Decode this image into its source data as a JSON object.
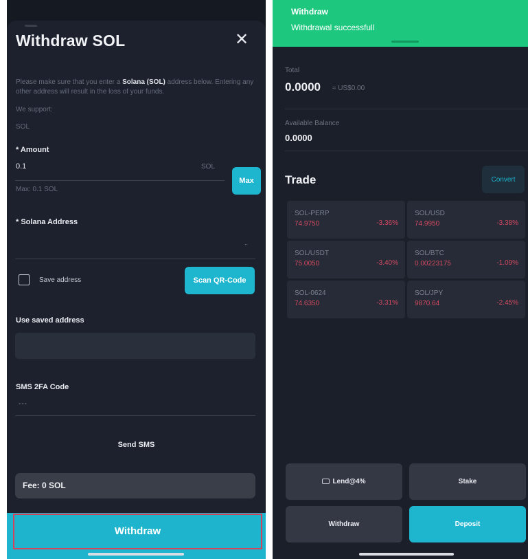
{
  "withdraw_form": {
    "title": "Withdraw SOL",
    "close_glyph": "✕",
    "warning_prefix": "Please make sure that you enter a ",
    "warning_bold": "Solana (SOL)",
    "warning_suffix": " address below. Entering any other address will result in the loss of your funds.",
    "support_label": "We support:",
    "support_value": "SOL",
    "amount_label": "* Amount",
    "amount_value": "0.1",
    "amount_unit": "SOL",
    "max_button": "Max",
    "max_hint": "Max: 0.1 SOL",
    "address_label": "* Solana Address",
    "address_dots": "..",
    "save_address_label": "Save address",
    "save_address_checked": false,
    "scan_qr_button": "Scan QR-Code",
    "saved_address_label": "Use saved address",
    "sms_label": "SMS 2FA Code",
    "sms_placeholder": "---",
    "send_sms": "Send SMS",
    "fee": "Fee: 0 SOL",
    "withdraw_button": "Withdraw"
  },
  "wallet": {
    "toast_title": "Withdraw",
    "toast_message": "Withdrawal successfull",
    "total_label": "Total",
    "total_value": "0.0000",
    "total_usd": "≈ US$0.00",
    "available_label": "Available Balance",
    "available_value": "0.0000",
    "trade_title": "Trade",
    "convert_button": "Convert",
    "markets": [
      {
        "name": "SOL-PERP",
        "price": "74.9750",
        "change": "-3.36%"
      },
      {
        "name": "SOL/USD",
        "price": "74.9950",
        "change": "-3.38%"
      },
      {
        "name": "SOL/USDT",
        "price": "75.0050",
        "change": "-3.40%"
      },
      {
        "name": "SOL/BTC",
        "price": "0.00223175",
        "change": "-1.09%"
      },
      {
        "name": "SOL-0624",
        "price": "74.6350",
        "change": "-3.31%"
      },
      {
        "name": "SOL/JPY",
        "price": "9870.64",
        "change": "-2.45%"
      }
    ],
    "lend_button": "Lend@4%",
    "stake_button": "Stake",
    "withdraw_button": "Withdraw",
    "deposit_button": "Deposit"
  },
  "colors": {
    "accent_cyan": "#1eb6cf",
    "toast_green": "#1dc87e",
    "negative_red": "#d64a62",
    "highlight_border": "#d0455b"
  }
}
